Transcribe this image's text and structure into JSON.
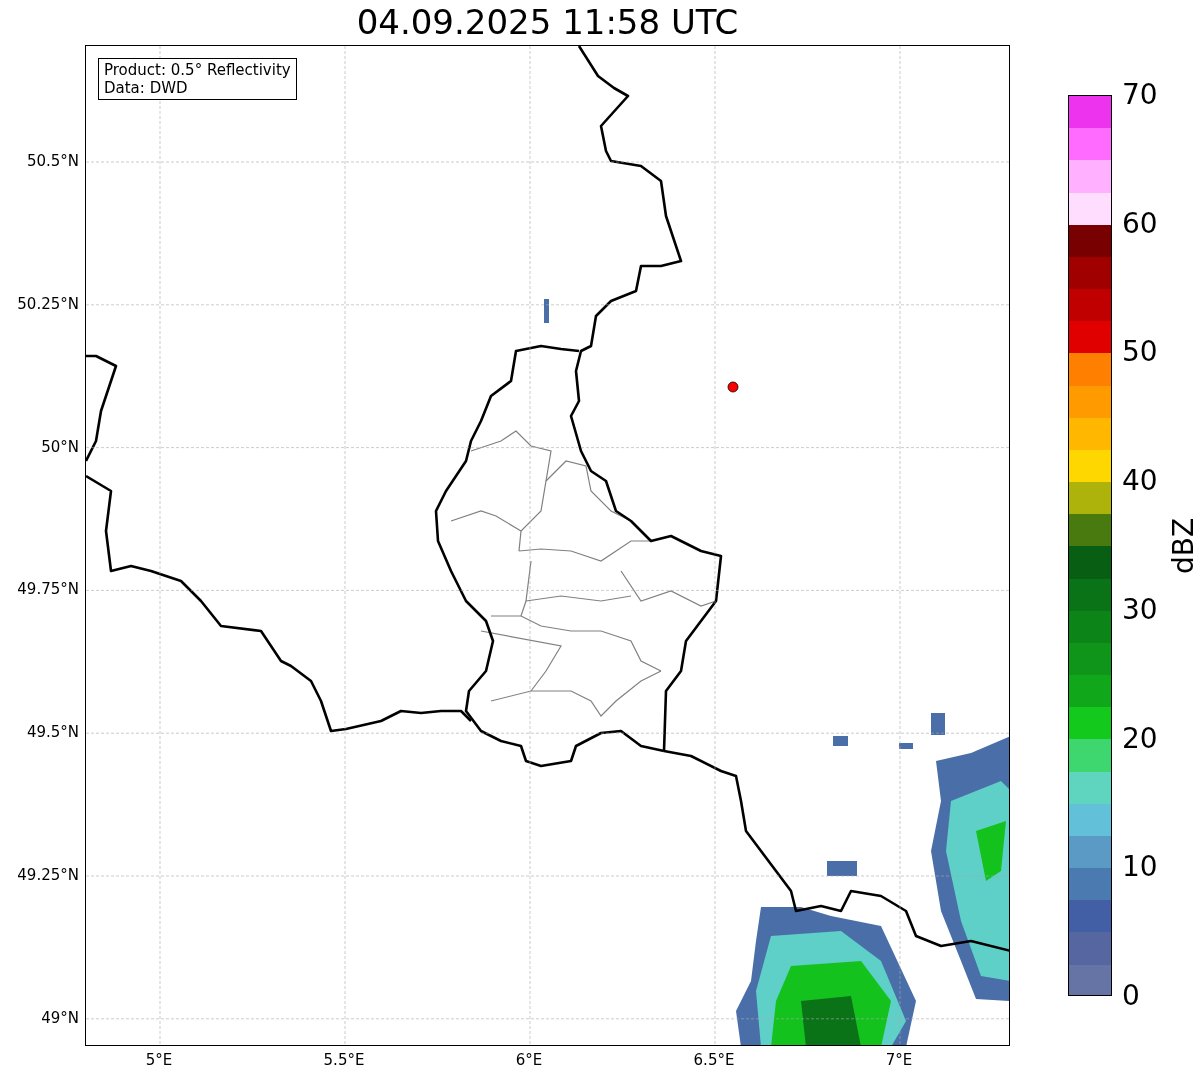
{
  "title": "04.09.2025 11:58 UTC",
  "legend": {
    "lines": [
      "Product: 0.5° Reflectivity",
      "Data: DWD"
    ]
  },
  "map": {
    "xticks": [
      "5°E",
      "5.5°E",
      "6°E",
      "6.5°E",
      "7°E"
    ],
    "yticks": [
      "50.5°N",
      "50.25°N",
      "50°N",
      "49.75°N",
      "49.5°N",
      "49.25°N",
      "49°N"
    ]
  },
  "colorbar": {
    "label": "dBZ",
    "ticks": [
      "70",
      "60",
      "50",
      "40",
      "30",
      "20",
      "10",
      "0"
    ],
    "bins": [
      {
        "color": "#ee33ee"
      },
      {
        "color": "#ff6bff"
      },
      {
        "color": "#ffb0ff"
      },
      {
        "color": "#ffddff"
      },
      {
        "color": "#780000"
      },
      {
        "color": "#a00000"
      },
      {
        "color": "#c00000"
      },
      {
        "color": "#e00000"
      },
      {
        "color": "#ff7f00"
      },
      {
        "color": "#ff9b00"
      },
      {
        "color": "#ffb700"
      },
      {
        "color": "#ffd700"
      },
      {
        "color": "#adb30a"
      },
      {
        "color": "#487a10"
      },
      {
        "color": "#085e12"
      },
      {
        "color": "#0a7217"
      },
      {
        "color": "#0c8418"
      },
      {
        "color": "#0e951a"
      },
      {
        "color": "#10a81a"
      },
      {
        "color": "#12c91c"
      },
      {
        "color": "#3dd66f"
      },
      {
        "color": "#5fd5c0"
      },
      {
        "color": "#62c0d8"
      },
      {
        "color": "#5a9ac4"
      },
      {
        "color": "#4a7ab0"
      },
      {
        "color": "#425ea4"
      },
      {
        "color": "#5566a0"
      },
      {
        "color": "#6573a5"
      }
    ]
  }
}
